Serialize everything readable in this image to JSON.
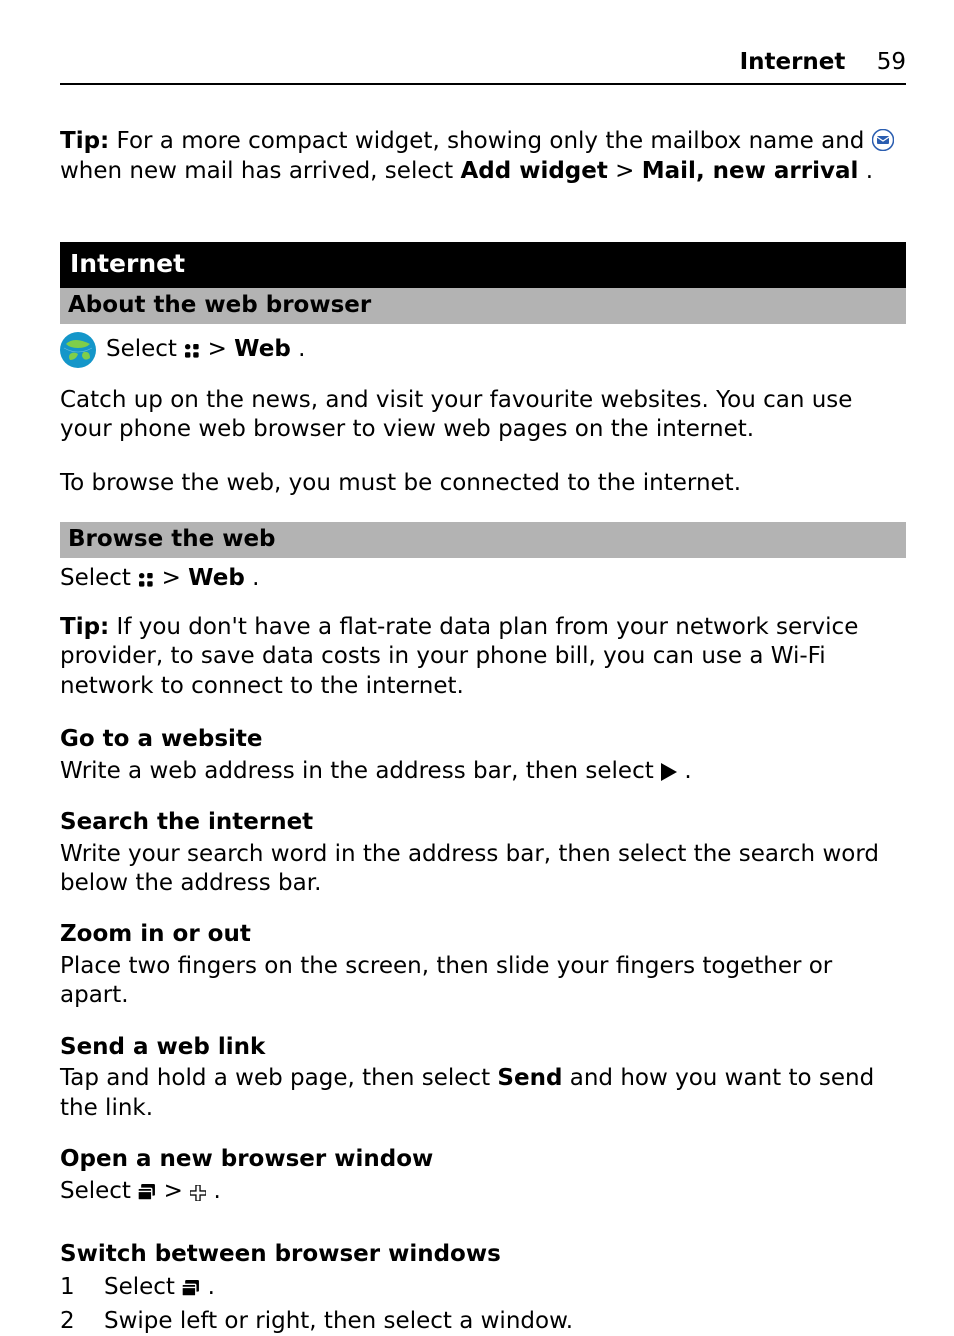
{
  "header": {
    "section": "Internet",
    "page_number": "59"
  },
  "tip_top": {
    "label": "Tip:",
    "text_before": "For a more compact widget, showing only the mailbox name and ",
    "text_after": " when new mail has arrived, select ",
    "bold1": "Add widget",
    "gt": " > ",
    "bold2": "Mail, new arrival",
    "period": "."
  },
  "section_title": "Internet",
  "about": {
    "title": "About the web browser",
    "select_text": "Select ",
    "gt": " > ",
    "web_label": "Web",
    "period": ".",
    "p1": "Catch up on the news, and visit your favourite websites. You can use your phone web browser to view web pages on the internet.",
    "p2": "To browse the web, you must be connected to the internet."
  },
  "browse": {
    "title": "Browse the web",
    "select_text": "Select ",
    "gt": " > ",
    "web_label": "Web",
    "period": ".",
    "tip_label": "Tip:",
    "tip_body": "If you don't have a flat-rate data plan from your network service provider, to save data costs in your phone bill, you can use a Wi-Fi network to connect to the internet."
  },
  "goto": {
    "title": "Go to a website",
    "body_before": "Write a web address in the address bar, then select ",
    "period": "."
  },
  "search": {
    "title": "Search the internet",
    "body": "Write your search word in the address bar, then select the search word below the address bar."
  },
  "zoom": {
    "title": "Zoom in or out",
    "body": "Place two fingers on the screen, then slide your fingers together or apart."
  },
  "sendlink": {
    "title": "Send a web link",
    "body_before": "Tap and hold a web page, then select ",
    "send_label": "Send",
    "body_after": " and how you want to send the link."
  },
  "newwin": {
    "title": "Open a new browser window",
    "select_text": "Select ",
    "gt": " > ",
    "period": "."
  },
  "switch": {
    "title": "Switch between browser windows",
    "step1_num": "1",
    "step1_before": "Select ",
    "step1_period": ".",
    "step2_num": "2",
    "step2_body": "Swipe left or right, then select a window."
  }
}
